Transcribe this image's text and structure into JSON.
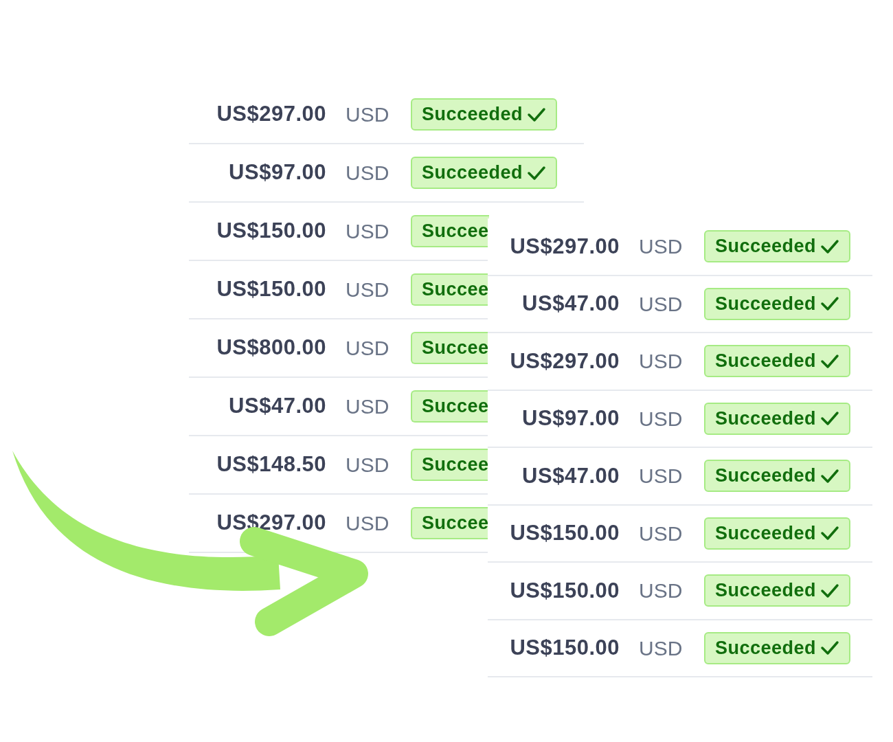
{
  "back_table": {
    "rows": [
      {
        "amount": "US$297.00",
        "currency": "USD",
        "status": "Succeeded",
        "cut": false
      },
      {
        "amount": "US$97.00",
        "currency": "USD",
        "status": "Succeeded",
        "cut": false
      },
      {
        "amount": "US$150.00",
        "currency": "USD",
        "status": "Succee",
        "cut": true
      },
      {
        "amount": "US$150.00",
        "currency": "USD",
        "status": "Succee",
        "cut": true
      },
      {
        "amount": "US$800.00",
        "currency": "USD",
        "status": "Succee",
        "cut": true
      },
      {
        "amount": "US$47.00",
        "currency": "USD",
        "status": "Succee",
        "cut": true
      },
      {
        "amount": "US$148.50",
        "currency": "USD",
        "status": "Succee",
        "cut": true
      },
      {
        "amount": "US$297.00",
        "currency": "USD",
        "status": "Succee",
        "cut": true
      }
    ]
  },
  "front_table": {
    "rows": [
      {
        "amount": "US$297.00",
        "currency": "USD",
        "status": "Succeeded",
        "cut": false
      },
      {
        "amount": "US$47.00",
        "currency": "USD",
        "status": "Succeeded",
        "cut": false
      },
      {
        "amount": "US$297.00",
        "currency": "USD",
        "status": "Succeeded",
        "cut": false
      },
      {
        "amount": "US$97.00",
        "currency": "USD",
        "status": "Succeeded",
        "cut": false
      },
      {
        "amount": "US$47.00",
        "currency": "USD",
        "status": "Succeeded",
        "cut": false
      },
      {
        "amount": "US$150.00",
        "currency": "USD",
        "status": "Succeeded",
        "cut": false
      },
      {
        "amount": "US$150.00",
        "currency": "USD",
        "status": "Succeeded",
        "cut": false
      },
      {
        "amount": "US$150.00",
        "currency": "USD",
        "status": "Succeeded",
        "cut": false
      }
    ]
  }
}
